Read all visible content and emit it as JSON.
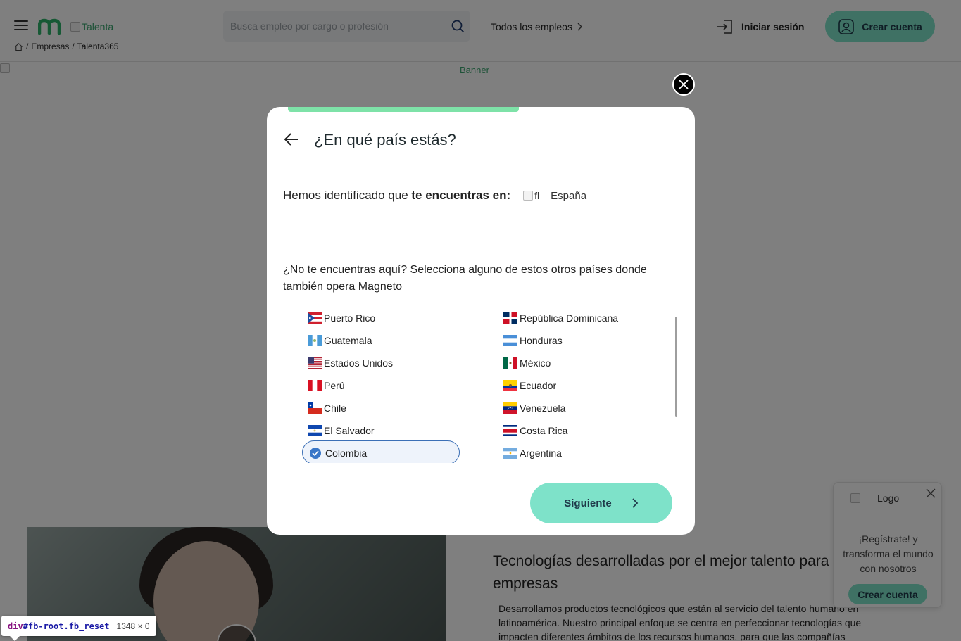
{
  "header": {
    "logo_alt": "Talenta",
    "breadcrumb": {
      "sep": "/",
      "empresas": "Empresas",
      "current": "Talenta365"
    },
    "search_placeholder": "Busca empleo por cargo o profesión",
    "nav_all_jobs": "Todos los empleos",
    "login": "Iniciar sesión",
    "create_account": "Crear cuenta"
  },
  "banner_alt": "Banner",
  "page": {
    "section_title_line1": "Tecnologías desarrolladas por el mejor talento para grandes",
    "section_title_line2": "empresas",
    "section_text": "Desarrollamos productos tecnológicos que están al servicio del talento humano en latinoamérica. Nuestro principal enfoque se centra en perfeccionar tecnologías que impacten diferentes ámbitos de los recursos humanos, para que las compañías"
  },
  "promo": {
    "logo_alt": "Logo",
    "text": "¡Regístrate! y transforma el mundo con nosotros",
    "button": "Crear cuenta"
  },
  "devtools_tip": {
    "selector_tag": "div",
    "selector_rest": "#fb-root.fb_reset",
    "dims": "1348 × 0"
  },
  "modal": {
    "progress_fraction": 0.54,
    "title": "¿En qué país estás?",
    "detected_prefix": "Hemos identificado que ",
    "detected_bold": "te encuentras en:",
    "detected_flag_alt": "fl",
    "detected_country": "España",
    "question": "¿No te encuentras aquí? Selecciona alguno de estos otros países donde también opera Magneto",
    "countries_left": [
      "Puerto Rico",
      "Guatemala",
      "Estados Unidos",
      "Perú",
      "Chile",
      "El Salvador",
      "Colombia"
    ],
    "countries_right": [
      "República Dominicana",
      "Honduras",
      "México",
      "Ecuador",
      "Venezuela",
      "Costa Rica",
      "Argentina"
    ],
    "selected_country": "Colombia",
    "next_button": "Siguiente"
  },
  "colors": {
    "accent": "#7ee2c9",
    "progress": "#7ee2a8",
    "selected_border": "#3b6fb6",
    "brand_green": "#3aa46f"
  }
}
